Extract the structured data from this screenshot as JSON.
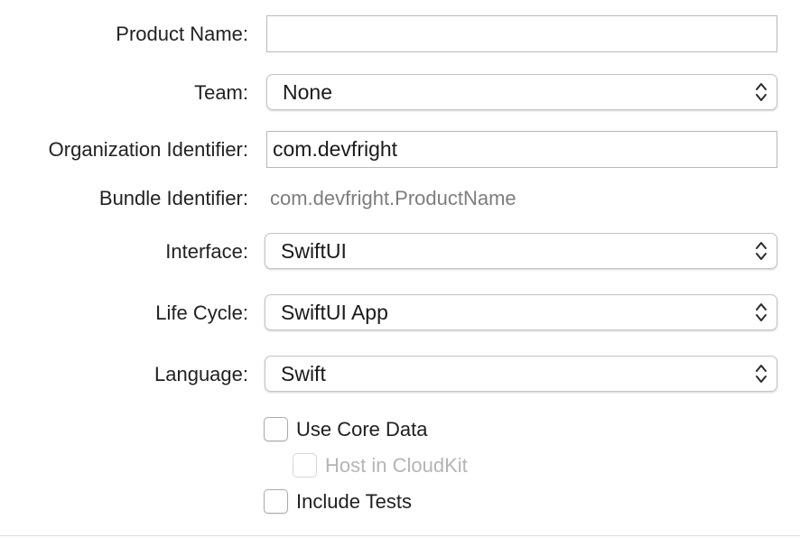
{
  "form": {
    "product_name": {
      "label": "Product Name:",
      "value": ""
    },
    "team": {
      "label": "Team:",
      "value": "None"
    },
    "organization_identifier": {
      "label": "Organization Identifier:",
      "value": "com.devfright"
    },
    "bundle_identifier": {
      "label": "Bundle Identifier:",
      "value": "com.devfright.ProductName"
    },
    "interface": {
      "label": "Interface:",
      "value": "SwiftUI"
    },
    "life_cycle": {
      "label": "Life Cycle:",
      "value": "SwiftUI App"
    },
    "language": {
      "label": "Language:",
      "value": "Swift"
    }
  },
  "options": {
    "use_core_data": {
      "label": "Use Core Data",
      "checked": false
    },
    "host_in_cloudkit": {
      "label": "Host in CloudKit",
      "checked": false,
      "enabled": false
    },
    "include_tests": {
      "label": "Include Tests",
      "checked": false
    }
  },
  "icons": {
    "popup_indicator": "chevron-up-down-icon"
  }
}
